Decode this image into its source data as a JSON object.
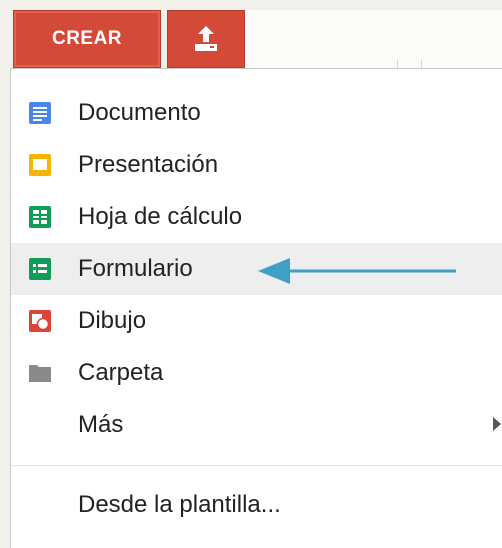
{
  "toolbar": {
    "create_label": "CREAR",
    "upload_icon": "upload-icon"
  },
  "menu": {
    "items": [
      {
        "label": "Documento",
        "icon": "document-icon",
        "color": "#4a86e8"
      },
      {
        "label": "Presentación",
        "icon": "presentation-icon",
        "color": "#f4b400"
      },
      {
        "label": "Hoja de cálculo",
        "icon": "spreadsheet-icon",
        "color": "#0f9d58"
      },
      {
        "label": "Formulario",
        "icon": "form-icon",
        "color": "#0f9d58"
      },
      {
        "label": "Dibujo",
        "icon": "drawing-icon",
        "color": "#db4437"
      },
      {
        "label": "Carpeta",
        "icon": "folder-icon",
        "color": "#8a8a8a"
      },
      {
        "label": "Más",
        "icon": "chevron-right-icon"
      }
    ],
    "template_label": "Desde la plantilla..."
  },
  "annotation": {
    "color": "#3da0c4",
    "target": "Formulario"
  }
}
